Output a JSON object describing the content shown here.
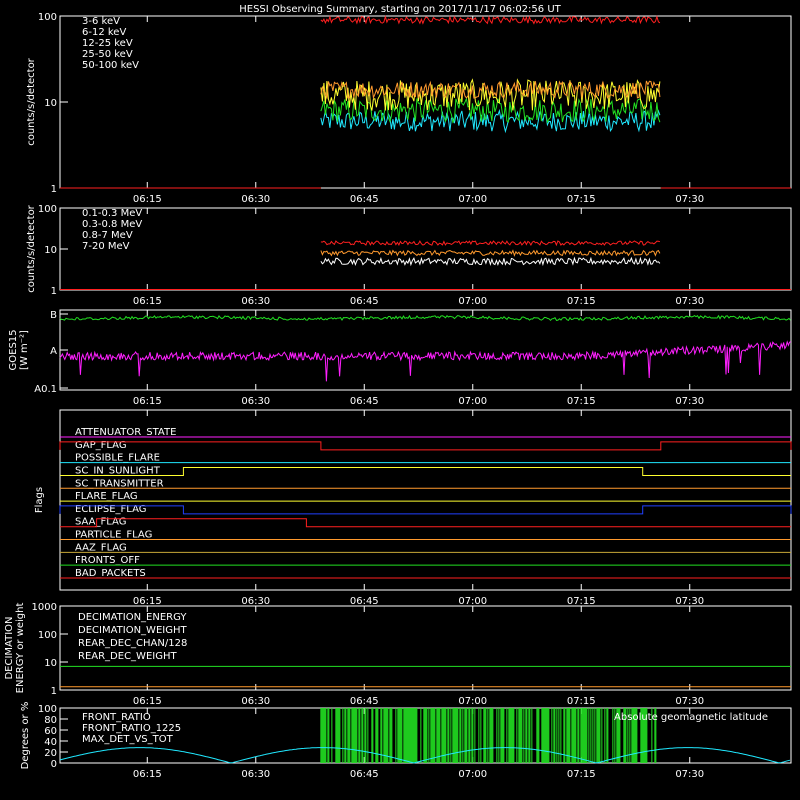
{
  "title": "HESSI Observing Summary, starting on 2017/11/17 06:02:56 UT",
  "time_ticks": [
    "06:15",
    "06:30",
    "06:45",
    "07:00",
    "07:15",
    "07:30"
  ],
  "chart_data": [
    {
      "type": "line",
      "panel": "xray_low",
      "ylabel": "counts/s/detector",
      "yscale": "log",
      "ylim": [
        1,
        100
      ],
      "yticks": [
        "1",
        "10",
        "100"
      ],
      "x_range_utc": [
        "06:02:56",
        "07:44:00"
      ],
      "observing_interval_utc": [
        "06:39:00",
        "07:26:00"
      ],
      "series": [
        {
          "name": "3-6 keV",
          "color": "#ff2020",
          "level": 90,
          "spread": 0.04
        },
        {
          "name": "6-12 keV",
          "color": "#ff9a2e",
          "level": 14,
          "spread": 0.1
        },
        {
          "name": "12-25 keV",
          "color": "#ffff30",
          "level": 12,
          "spread": 0.18
        },
        {
          "name": "25-50 keV",
          "color": "#22e022",
          "level": 8,
          "spread": 0.14
        },
        {
          "name": "50-100 keV",
          "color": "#20e8ff",
          "level": 6,
          "spread": 0.12
        }
      ]
    },
    {
      "type": "line",
      "panel": "gamma",
      "ylabel": "counts/s/detector",
      "yscale": "log",
      "ylim": [
        1,
        100
      ],
      "yticks": [
        "1",
        "10",
        "100"
      ],
      "observing_interval_utc": [
        "06:39:00",
        "07:26:00"
      ],
      "series": [
        {
          "name": "0.1-0.3 MeV",
          "color": "#ff2020",
          "level": 14,
          "spread": 0.05
        },
        {
          "name": "0.3-0.8 MeV",
          "color": "#ff9a2e",
          "level": 8,
          "spread": 0.06
        },
        {
          "name": "0.8-7 MeV",
          "color": "#ffffff",
          "level": 5,
          "spread": 0.08
        },
        {
          "name": "7-20 MeV",
          "color": "#22e022",
          "level": 1,
          "spread": 0.0
        }
      ]
    },
    {
      "type": "line",
      "panel": "goes",
      "ylabel": "GOES15 [W m⁻²]",
      "ylabel_lines": [
        "GOES15",
        "[W m⁻²]"
      ],
      "yscale": "log",
      "yticks": [
        "A0.1",
        "A",
        "B"
      ],
      "series": [
        {
          "name": "GOES long",
          "color": "#22e022"
        },
        {
          "name": "GOES short",
          "color": "#ff20ff"
        }
      ]
    },
    {
      "type": "line",
      "panel": "flags",
      "ylabel": "Flags",
      "flags": [
        {
          "name": "ATTENUATOR_STATE",
          "color": "#ff20ff",
          "on": []
        },
        {
          "name": "GAP_FLAG",
          "color": "#ff2020",
          "on": [
            [
              "06:02:56",
              "06:39:00"
            ],
            [
              "07:26:00",
              "07:44:00"
            ]
          ]
        },
        {
          "name": "POSSIBLE_FLARE",
          "color": "#20e8ff",
          "on": []
        },
        {
          "name": "SC_IN_SUNLIGHT",
          "color": "#ffff30",
          "on": [
            [
              "06:20:00",
              "07:23:30"
            ]
          ]
        },
        {
          "name": "SC_TRANSMITTER",
          "color": "#ff9a2e",
          "on": []
        },
        {
          "name": "FLARE_FLAG",
          "color": "#ffff30",
          "on": []
        },
        {
          "name": "ECLIPSE_FLAG",
          "color": "#2040ff",
          "on": [
            [
              "06:02:56",
              "06:20:00"
            ],
            [
              "07:23:30",
              "07:44:00"
            ]
          ]
        },
        {
          "name": "SAA_FLAG",
          "color": "#ff2020",
          "on": [
            [
              "06:08:00",
              "06:37:00"
            ]
          ]
        },
        {
          "name": "PARTICLE_FLAG",
          "color": "#ff9a2e",
          "on": []
        },
        {
          "name": "AAZ_FLAG",
          "color": "#c8a838",
          "on": []
        },
        {
          "name": "FRONTS_OFF",
          "color": "#22e022",
          "on": []
        },
        {
          "name": "BAD_PACKETS",
          "color": "#ff2020",
          "on": []
        }
      ]
    },
    {
      "type": "line",
      "panel": "decimation",
      "ylabel": "DECIMATION ENERGY or weight",
      "ylabel_lines": [
        "DECIMATION",
        "ENERGY or weight"
      ],
      "yscale": "log",
      "ylim": [
        1,
        1000
      ],
      "yticks": [
        "1",
        "10",
        "100",
        "1000"
      ],
      "series": [
        {
          "name": "DECIMATION_ENERGY",
          "color": "#22e022",
          "level": 7
        },
        {
          "name": "DECIMATION_WEIGHT",
          "color": "#ff9a2e",
          "level": 1.3
        },
        {
          "name": "REAR_DEC_CHAN/128",
          "color": "#20e8ff",
          "level": null
        },
        {
          "name": "REAR_DEC_WEIGHT",
          "color": "#c8a838",
          "level": null
        }
      ]
    },
    {
      "type": "line",
      "panel": "ratio",
      "ylabel": "Degrees or %",
      "ylim": [
        0,
        100
      ],
      "yticks": [
        "0",
        "20",
        "40",
        "60",
        "80",
        "100"
      ],
      "annotation": "Absolute geomagnetic latitude",
      "observing_interval_utc": [
        "06:39:00",
        "07:26:00"
      ],
      "series": [
        {
          "name": "FRONT_RATIO",
          "color": "#ffff30"
        },
        {
          "name": "FRONT_RATIO_1225",
          "color": "#22e022"
        },
        {
          "name": "MAX_DET_VS_TOT",
          "color": "#ff9a2e"
        },
        {
          "name": "Absolute geomagnetic latitude",
          "color": "#20e8ff",
          "min": 0,
          "max": 28
        }
      ]
    }
  ]
}
